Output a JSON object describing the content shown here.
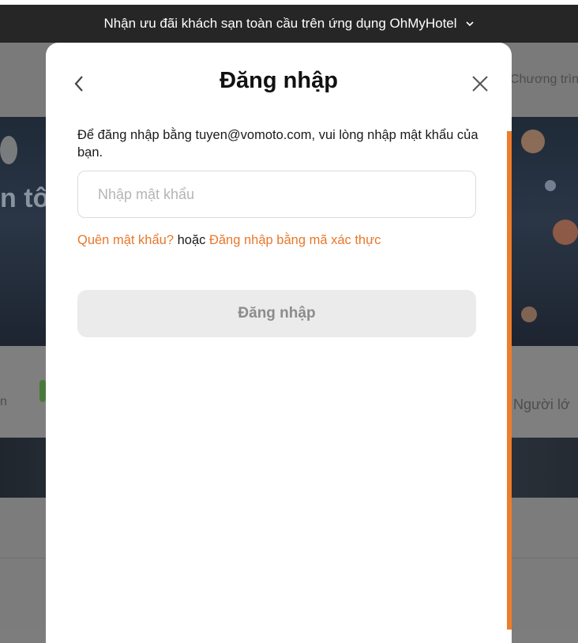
{
  "banner": {
    "text": "Nhận ưu đãi khách sạn toàn cầu trên ứng dụng OhMyHotel",
    "chevron_icon": "chevron-down-icon"
  },
  "background": {
    "nav_partial": "Chương trình",
    "hero_partial": "n tôi",
    "people_partial": "Người lớ",
    "left_partial": "n"
  },
  "modal": {
    "title": "Đăng nhập",
    "back_icon": "chevron-left-icon",
    "close_icon": "close-icon",
    "description": "Để đăng nhập bằng tuyen@vomoto.com, vui lòng nhập mật khẩu của bạn.",
    "password": {
      "value": "",
      "placeholder": "Nhập mật khẩu"
    },
    "forgot_link": "Quên mật khẩu?",
    "or_text": "hoặc",
    "otp_link": "Đăng nhập bằng mã xác thực",
    "submit_label": "Đăng nhập"
  },
  "colors": {
    "accent": "#e8772b",
    "banner_bg": "#262626",
    "button_disabled_bg": "#ebebeb"
  }
}
